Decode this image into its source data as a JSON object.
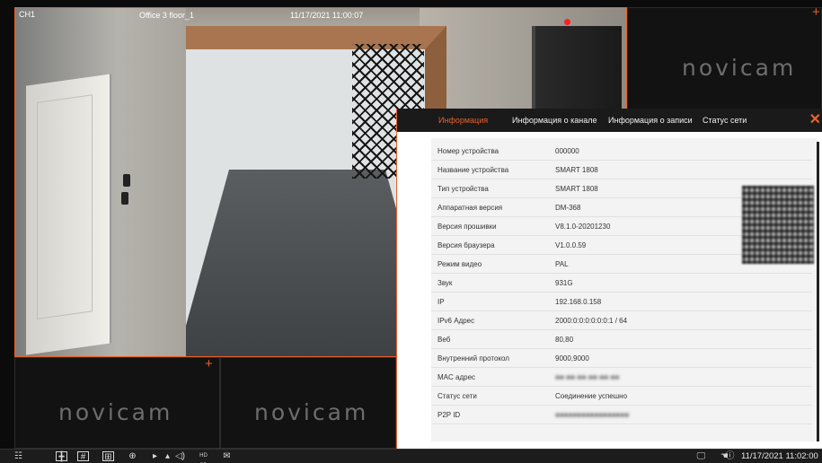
{
  "channel_main": {
    "name": "CH1",
    "location": "Office 3 floor_1",
    "datetime": "11/17/2021 11:00:07"
  },
  "brand_logo": "novicam",
  "dialog": {
    "tabs": [
      {
        "label": "Информация",
        "active": true
      },
      {
        "label": "Информация о канале",
        "active": false
      },
      {
        "label": "Информация о записи",
        "active": false
      },
      {
        "label": "Статус сети",
        "active": false
      }
    ],
    "rows": [
      {
        "label": "Номер устройства",
        "value": "000000"
      },
      {
        "label": "Название устройства",
        "value": "SMART 1808"
      },
      {
        "label": "Тип устройства",
        "value": "SMART 1808"
      },
      {
        "label": "Аппаратная версия",
        "value": "DM-368"
      },
      {
        "label": "Версия прошивки",
        "value": "V8.1.0-20201230"
      },
      {
        "label": "Версия браузера",
        "value": "V1.0.0.59"
      },
      {
        "label": "Режим видео",
        "value": "PAL"
      },
      {
        "label": "Звук",
        "value": "931G"
      },
      {
        "label": "IP",
        "value": "192.168.0.158"
      },
      {
        "label": "IPv6 Адрес",
        "value": "2000:0:0:0:0:0:0:1 / 64"
      },
      {
        "label": "Веб",
        "value": "80,80"
      },
      {
        "label": "Внутренний протокол",
        "value": "9000,9000"
      },
      {
        "label": "MAC адрес",
        "value": "",
        "blurred": true
      },
      {
        "label": "Статус сети",
        "value": "Соединение успешно"
      },
      {
        "label": "P2P ID",
        "value": "",
        "blurred": true
      }
    ]
  },
  "taskbar": {
    "datetime": "11/17/2021 11:02:00"
  },
  "colors": {
    "accent": "#e8622b",
    "record": "#ff2020"
  },
  "icons": [
    "menu-icon",
    "layout-4-icon",
    "layout-9-icon",
    "layout-fullscreen-icon",
    "ptz-icon",
    "playback-icon",
    "audio-icon",
    "hd-sd-icon",
    "snapshot-icon",
    "network-icon",
    "hand-icon",
    "info-icon"
  ]
}
